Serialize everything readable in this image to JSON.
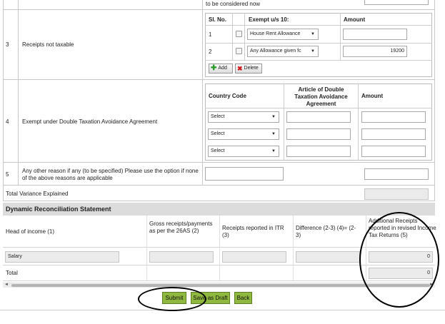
{
  "top": {
    "text": "to be considered now"
  },
  "row3": {
    "no": "3",
    "label": "Receipts not taxable",
    "table": {
      "headers": {
        "sl": "Sl. No.",
        "exempt": "Exempt u/s 10:",
        "amount": "Amount"
      },
      "rows": [
        {
          "sl": "1",
          "exempt": "House Rent Allowance",
          "amount": ""
        },
        {
          "sl": "2",
          "exempt": "Any Allowance given fc",
          "amount": "19200"
        }
      ]
    },
    "add_label": "Add",
    "delete_label": "Delete"
  },
  "row4": {
    "no": "4",
    "label": "Exempt under Double Taxation Avoidance Agreement",
    "headers": {
      "country": "Country Code",
      "article": "Article of Double Taxation Avoidance Agreement",
      "amount": "Amount"
    },
    "selects": [
      "Select",
      "Select",
      "Select"
    ]
  },
  "row5": {
    "no": "5",
    "label": "Any other reason if any (to be specified) Please use the option if none of the above reasons are applicable"
  },
  "variance": {
    "label": "Total Variance Explained",
    "value": ""
  },
  "drs": {
    "title": "Dynamic Reconciliation Statement",
    "headers": {
      "head": "Head of income (1)",
      "gross": "Gross receipts/payments as per the 26AS (2)",
      "itr": "Receipts reported in ITR (3)",
      "diff": "Difference (2-3) (4)= (2-3)",
      "additional": "Additional Receipts reported in revised Income Tax Returns (5)"
    },
    "salary": {
      "label": "Salary",
      "gross": "",
      "itr": "",
      "diff": "",
      "additional": "0"
    },
    "total": {
      "label": "Total",
      "value": "0"
    }
  },
  "buttons": {
    "submit": "Submit",
    "draft": "Save as Draft",
    "back": "Back"
  },
  "colors": {
    "header_bg": "#dcdcdc",
    "button_green": "#8fb93e"
  }
}
